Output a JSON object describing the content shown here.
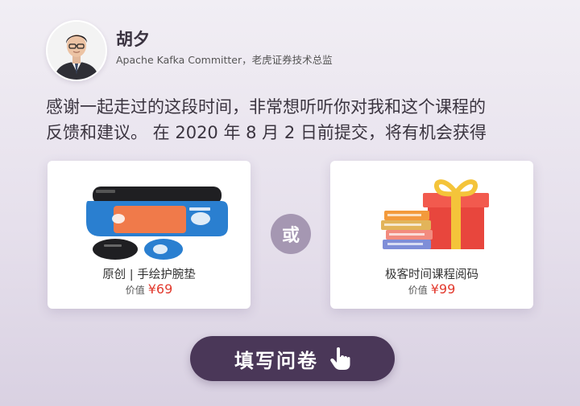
{
  "author": {
    "name": "胡夕",
    "title": "Apache Kafka Committer，老虎证券技术总监"
  },
  "message": {
    "line1": "感谢一起走过的这段时间，非常想听听你对我和这个课程的",
    "line2": "反馈和建议。 在 2020 年 8 月 2 日前提交，将有机会获得"
  },
  "rewards": [
    {
      "title": "原创 | 手绘护腕垫",
      "price_label": "价值",
      "price": "¥69",
      "icon": "wrist-rest-image"
    },
    {
      "title": "极客时间课程阅码",
      "price_label": "价值",
      "price": "¥99",
      "icon": "gift-books-image"
    }
  ],
  "or_label": "或",
  "survey_button": {
    "label": "填写问卷",
    "icon": "hand-pointer-icon"
  },
  "colors": {
    "button_bg": "#4a3758",
    "or_badge_bg": "#a597b2",
    "price_red": "#e23a2e",
    "mousepad_blue": "#2a7fd0"
  }
}
